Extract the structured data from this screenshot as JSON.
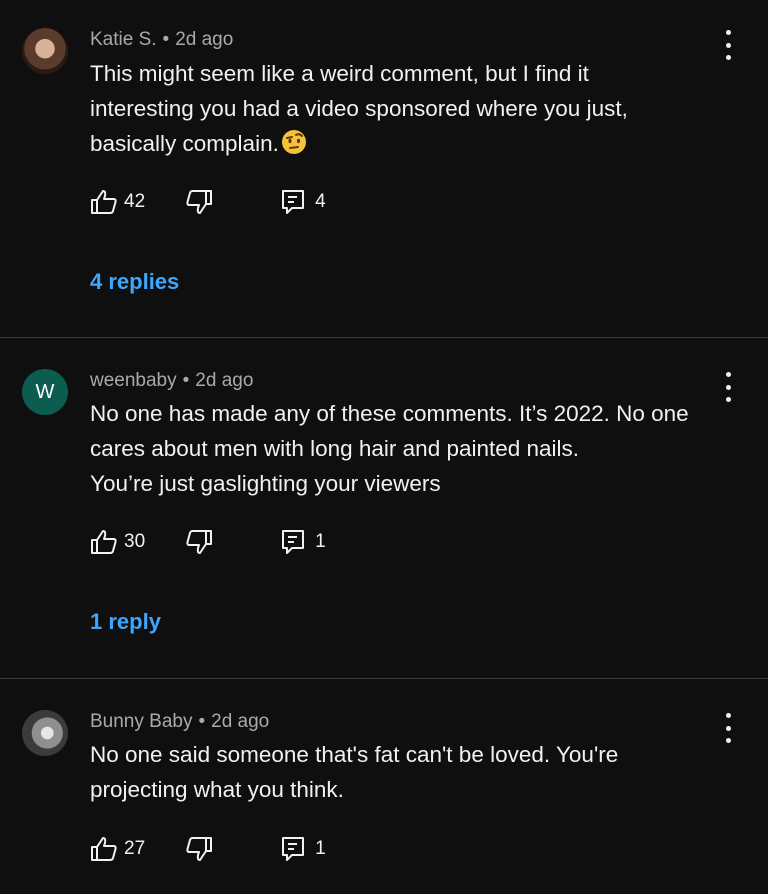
{
  "comments": [
    {
      "author": "Katie S.",
      "time": "2d ago",
      "lines": [
        "This might seem like a weird comment, but I find it",
        "interesting you had a video sponsored where you just,",
        "basically complain."
      ],
      "emoji": "raised-eyebrow-face-emoji",
      "likes": "42",
      "reply_count": "4",
      "replies_link": "4 replies",
      "avatar": "photo"
    },
    {
      "author": "weenbaby",
      "time": "2d ago",
      "avatar_letter": "W",
      "avatar_color": "#0b5d4f",
      "lines": [
        "No one has made any of these comments. It’s 2022. No one",
        "cares about men with long hair and painted nails.",
        "You’re just gaslighting your viewers"
      ],
      "likes": "30",
      "reply_count": "1",
      "replies_link": "1 reply"
    },
    {
      "author": "Bunny Baby",
      "time": "2d ago",
      "avatar": "photo",
      "lines": [
        "No one said someone that's fat can't be loved. You're",
        "projecting what you think."
      ],
      "likes": "27",
      "reply_count": "1"
    }
  ],
  "separator": "•",
  "icons": {
    "like": "thumbs-up-icon",
    "dislike": "thumbs-down-icon",
    "reply": "comment-reply-icon",
    "menu": "more-vertical-icon"
  },
  "colors": {
    "background": "#0f0f0f",
    "link": "#3ea6ff",
    "meta": "#aaaaaa",
    "divider": "#3a3a3a"
  }
}
